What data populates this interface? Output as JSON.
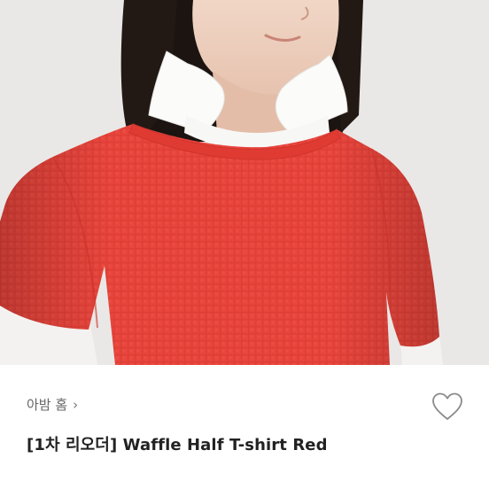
{
  "product": {
    "image_alt": "Model wearing a red waffle knit short-sleeve T-shirt over a white collared shirt",
    "brand_label": "아밤 홈",
    "brand_chevron": "›",
    "title": "[1차 리오더] Waffle Half T-shirt Red",
    "wishlist_icon": "heart-outline-icon"
  },
  "colors": {
    "shirt_red": "#e8453c",
    "background": "#e9e8e6",
    "brand_text": "#666666",
    "title_text": "#222222"
  }
}
